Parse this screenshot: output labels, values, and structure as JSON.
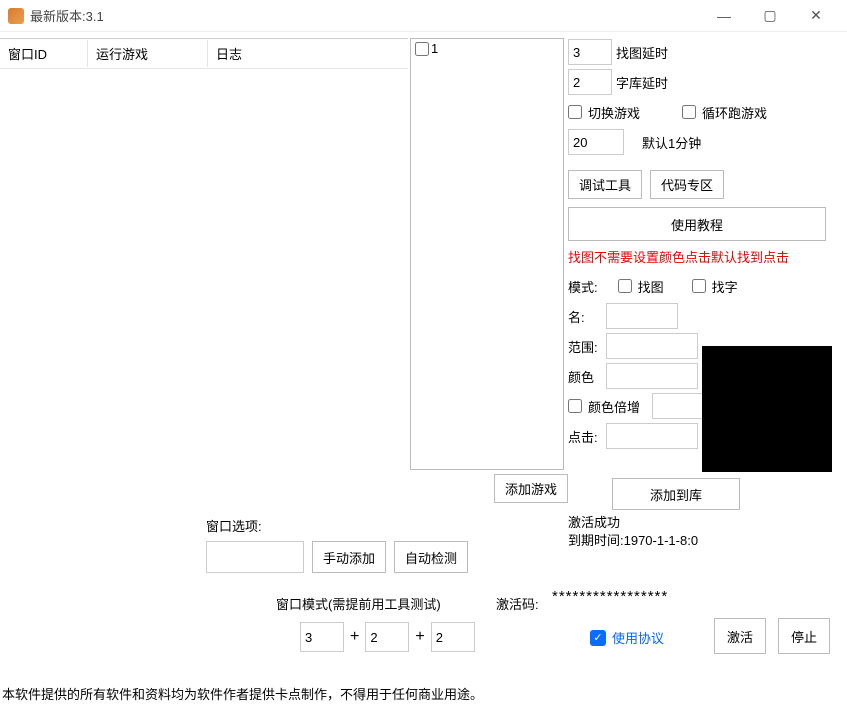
{
  "window": {
    "title": "最新版本:3.1"
  },
  "table": {
    "headers": [
      "窗口ID",
      "运行游戏",
      "日志"
    ]
  },
  "game_list": {
    "items": [
      {
        "label": "1",
        "checked": false
      }
    ]
  },
  "right": {
    "find_image_delay": {
      "value": "3",
      "label": "找图延时"
    },
    "font_lib_delay": {
      "value": "2",
      "label": "字库延时"
    },
    "switch_game_label": "切换游戏",
    "loop_game_label": "循环跑游戏",
    "interval": {
      "value": "20",
      "label": "默认1分钟"
    },
    "debug_btn": "调试工具",
    "code_btn": "代码专区",
    "tutorial_btn": "使用教程",
    "red_hint": "找图不需要设置颜色点击默认找到点击",
    "mode_label": "模式:",
    "find_img_cb": "找图",
    "find_text_cb": "找字",
    "name_label": "名:",
    "range_label": "范围:",
    "color_label": "颜色",
    "color_multi_label": "颜色倍增",
    "click_label": "点击:",
    "name_value": "",
    "range_value": "",
    "color_value": "",
    "color_multi_value": "",
    "click_value": ""
  },
  "add_game_btn": "添加游戏",
  "add_lib_btn": "添加到库",
  "activation": {
    "success": "激活成功",
    "expiry": "到期时间:1970-1-1-8:0"
  },
  "win_opts": {
    "header": "窗口选项:",
    "manual_btn": "手动添加",
    "auto_btn": "自动检测",
    "input_value": "",
    "mode_label": "窗口模式(需提前用工具测试)",
    "m1": "3",
    "m2": "2",
    "m3": "2"
  },
  "act_code": {
    "label": "激活码:",
    "value": "*****************"
  },
  "agree": {
    "label": "使用协议",
    "checked": true
  },
  "activate_btn": "激活",
  "stop_btn": "停止",
  "footer": "本软件提供的所有软件和资料均为软件作者提供卡点制作，不得用于任何商业用途。"
}
